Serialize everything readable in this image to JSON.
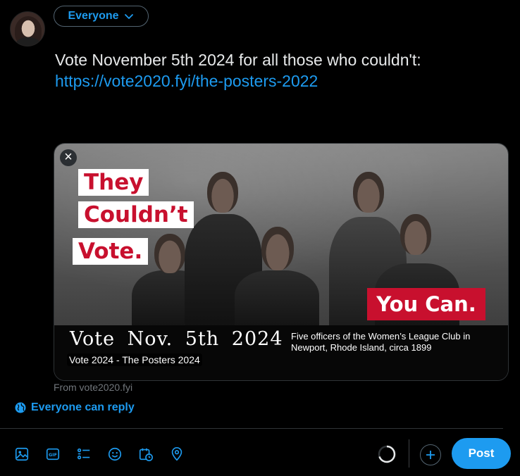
{
  "composer": {
    "audience_label": "Everyone",
    "text_line": "Vote November 5th 2024 for all those who couldn't:",
    "link": "https://vote2020.fyi/the-posters-2022"
  },
  "card": {
    "poster": {
      "they": "They",
      "couldnt": "Couldn’t",
      "vote": "Vote.",
      "you_can": "You Can.",
      "date": "Vote Nov. 5th 2024",
      "caption_line1": "Five officers of the Women’s League Club in",
      "caption_line2": "Newport, Rhode Island, circa 1899"
    },
    "title": "Vote 2024 - The Posters 2024",
    "source": "From vote2020.fyi",
    "close_glyph": "×"
  },
  "reply_setting": "Everyone can reply",
  "toolbar": {
    "icons": [
      "image-icon",
      "gif-icon",
      "poll-icon",
      "emoji-icon",
      "schedule-icon",
      "location-icon"
    ],
    "post_label": "Post"
  },
  "colors": {
    "accent": "#1d9bf0",
    "background": "#000000",
    "poster_red": "#c8102e"
  }
}
